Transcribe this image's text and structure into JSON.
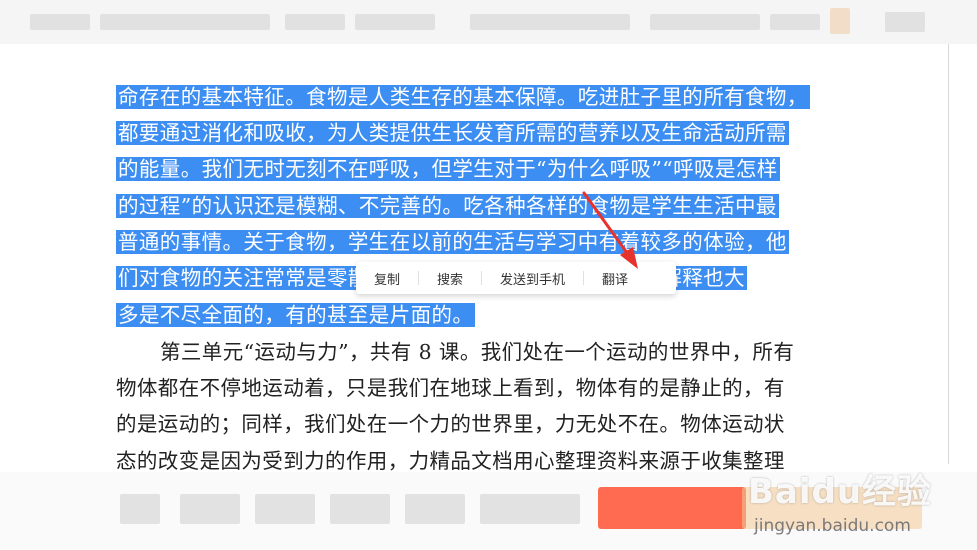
{
  "document": {
    "selected_lines": [
      "命存在的基本特征。食物是人类生存的基本保障。吃进肚子里的所有食物，",
      "都要通过消化和吸收，为人类提供生长发育所需的营养以及生命活动所需",
      "的能量。我们无时无刻不在呼吸，但学生对于“为什么呼吸”“呼吸是怎样",
      "的过程”的认识还是模糊、不完善的。吃各种各样的食物是学生生活中最",
      "普通的事情。关于食物，学生在以前的生活与学习中有着较多的体验，他",
      "们对食物的关注常常是零散的、不系统的，从生活中得到的解释也大",
      "多是不尽全面的，有的甚至是片面的。"
    ],
    "plain_lines": [
      "第三单元“运动与力”，共有 8 课。我们处在一个运动的世界中，所有",
      "物体都在不停地运动着，只是我们在地球上看到，物体有的是静止的，有",
      "的是运动的；同样，我们处在一个力的世界里，力无处不在。物体运动状",
      "态的改变是因为受到力的作用，力精品文档用心整理资料来源于收集整理"
    ]
  },
  "context_menu": {
    "copy": "复制",
    "search": "搜索",
    "send_to_phone": "发送到手机",
    "translate": "翻译"
  },
  "watermark": {
    "logo": "Baidu经验",
    "url": "jingyan.baidu.com"
  },
  "colors": {
    "selection": "#3d8ef2",
    "arrow": "#e8322c",
    "action_red": "#ff5b3d"
  }
}
